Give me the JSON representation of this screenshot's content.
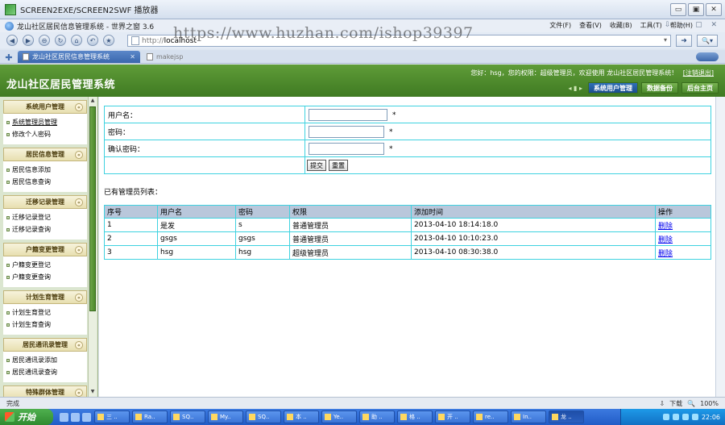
{
  "app": {
    "title": "SCREEN2EXE/SCREEN2SWF 播放器",
    "window_buttons": [
      "▭",
      "▣",
      "✕"
    ]
  },
  "browser": {
    "title": "龙山社区居民信息管理系统 - 世界之窗 3.6",
    "menu": [
      "文件(F)",
      "查看(V)",
      "收藏(B)",
      "工具(T)",
      "帮助(H)"
    ],
    "window_controls": "⇩ — ▢ ✕",
    "address_prefix": "http://",
    "address_host": "localhost",
    "watermark": "https://www.huzhan.com/ishop39397",
    "tabs": [
      {
        "label": "龙山社区居民信息管理系统",
        "active": true
      },
      {
        "label": "makejsp",
        "active": false
      }
    ]
  },
  "header": {
    "site_title": "龙山社区居民管理系统",
    "welcome": "您好：hsg，您的权限：超级管理员，欢迎使用 龙山社区居民管理系统！",
    "logout": "[注销退出]",
    "buttons": [
      "系统用户管理",
      "数据备份",
      "后台主页"
    ]
  },
  "sidebar": {
    "sections": [
      {
        "title": "系统用户管理",
        "items": [
          "系统管理员管理",
          "修改个人密码"
        ]
      },
      {
        "title": "居民信息管理",
        "items": [
          "居民信息添加",
          "居民信息查询"
        ]
      },
      {
        "title": "迁移记录管理",
        "items": [
          "迁移记录登记",
          "迁移记录查询"
        ]
      },
      {
        "title": "户籍变更管理",
        "items": [
          "户籍变更登记",
          "户籍变更查询"
        ]
      },
      {
        "title": "计划生育管理",
        "items": [
          "计划生育登记",
          "计划生育查询"
        ]
      },
      {
        "title": "居民通讯录管理",
        "items": [
          "居民通讯录添加",
          "居民通讯录查询"
        ]
      },
      {
        "title": "特殊群体管理",
        "items": []
      }
    ]
  },
  "form": {
    "username_label": "用户名：",
    "password_label": "密码：",
    "confirm_label": "确认密码：",
    "required_mark": "*",
    "submit_label": "提交",
    "reset_label": "重置"
  },
  "list": {
    "title": "已有管理员列表：",
    "columns": [
      "序号",
      "用户名",
      "密码",
      "权限",
      "添加时间",
      "操作"
    ],
    "rows": [
      [
        "1",
        "是发",
        "s",
        "普通管理员",
        "2013-04-10 18:14:18.0",
        "删除"
      ],
      [
        "2",
        "gsgs",
        "gsgs",
        "普通管理员",
        "2013-04-10 10:10:23.0",
        "删除"
      ],
      [
        "3",
        "hsg",
        "hsg",
        "超级管理员",
        "2013-04-10 08:30:38.0",
        "删除"
      ]
    ]
  },
  "status": {
    "left": "完成",
    "zoom": "100%",
    "download": "下载"
  },
  "taskbar": {
    "start": "开始",
    "items": [
      "三 ..",
      "Ra..",
      "SQ..",
      "My..",
      "SQ..",
      "本 ..",
      "Ye..",
      "助 ..",
      "格 ..",
      "开 ..",
      "re..",
      "In..",
      "龙 .."
    ],
    "clock": "22:06"
  }
}
